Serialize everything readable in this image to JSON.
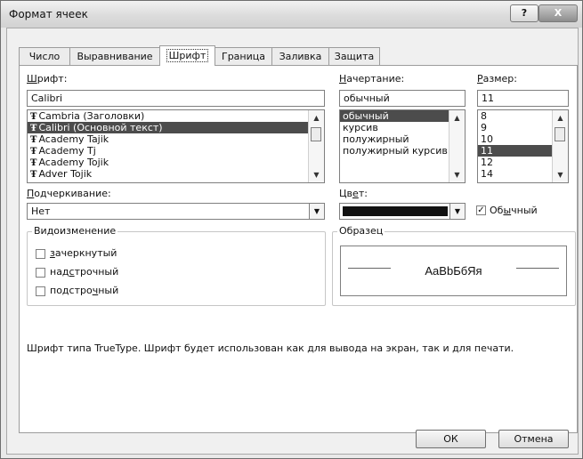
{
  "window": {
    "title": "Формат ячеек",
    "help": "?",
    "close": "X"
  },
  "tabs": [
    "Число",
    "Выравнивание",
    "Шрифт",
    "Граница",
    "Заливка",
    "Защита"
  ],
  "font": {
    "label_first": "Ш",
    "label_rest": "рифт:",
    "value": "Calibri",
    "items": [
      "Cambria (Заголовки)",
      "Calibri (Основной текст)",
      "Academy Tajik",
      "Academy Tj",
      "Academy Tojik",
      "Adver Tojik"
    ],
    "selected_index": 1,
    "icon_glyph": "Ŧ"
  },
  "style": {
    "label_first": "Н",
    "label_rest": "ачертание:",
    "value": "обычный",
    "items": [
      "обычный",
      "курсив",
      "полужирный",
      "полужирный курсив"
    ],
    "selected_index": 0
  },
  "size": {
    "label_first": "Р",
    "label_rest": "азмер:",
    "value": "11",
    "items": [
      "8",
      "9",
      "10",
      "11",
      "12",
      "14"
    ],
    "selected_index": 3
  },
  "underline": {
    "label_first": "П",
    "label_rest": "одчеркивание:",
    "value": "Нет"
  },
  "color": {
    "label_a": "Цв",
    "label_u": "е",
    "label_b": "т:",
    "swatch": "#111111",
    "normal_a": "Об",
    "normal_u": "ы",
    "normal_b": "чный",
    "normal_checked": "✓"
  },
  "effects": {
    "label": "Видоизменение",
    "strike_u": "з",
    "strike_rest": "ачеркнутый",
    "super_a": "над",
    "super_u": "с",
    "super_b": "трочный",
    "sub_a": "подстро",
    "sub_u": "ч",
    "sub_b": "ный"
  },
  "preview": {
    "label": "Образец",
    "text": "AaBbБбЯя"
  },
  "description": "Шрифт типа TrueType. Шрифт будет использован как для вывода на экран, так и для печати.",
  "buttons": {
    "ok": "ОК",
    "cancel": "Отмена"
  },
  "glyphs": {
    "up": "▲",
    "down": "▼"
  }
}
